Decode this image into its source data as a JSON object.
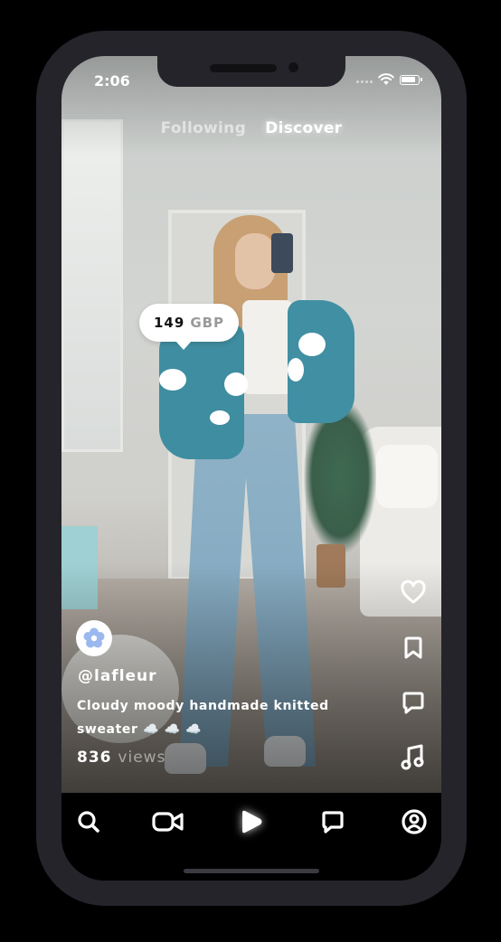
{
  "status_bar": {
    "time": "2:06",
    "battery_level": 0.9
  },
  "feed_tabs": [
    {
      "label": "Following",
      "active": false
    },
    {
      "label": "Discover",
      "active": true
    }
  ],
  "product_tag": {
    "amount": "149",
    "currency": "GBP"
  },
  "actions": [
    {
      "icon": "heart-icon"
    },
    {
      "icon": "bookmark-icon"
    },
    {
      "icon": "comment-icon"
    },
    {
      "icon": "music-note-icon"
    }
  ],
  "post": {
    "avatar_icon": "flower-icon",
    "username": "@lafleur",
    "caption": "Cloudy moody handmade knitted sweater ☁️ ☁️ ☁️",
    "views_count": "836",
    "views_label": "views"
  },
  "bottom_nav": [
    {
      "icon": "search-icon",
      "active": false
    },
    {
      "icon": "camera-icon",
      "active": false
    },
    {
      "icon": "play-icon",
      "active": true
    },
    {
      "icon": "chat-icon",
      "active": false
    },
    {
      "icon": "profile-icon",
      "active": false
    }
  ],
  "colors": {
    "frame": "#25242b",
    "cardigan": "#3f8da0",
    "accent": "#ffffff",
    "nav_background": "#000000"
  }
}
